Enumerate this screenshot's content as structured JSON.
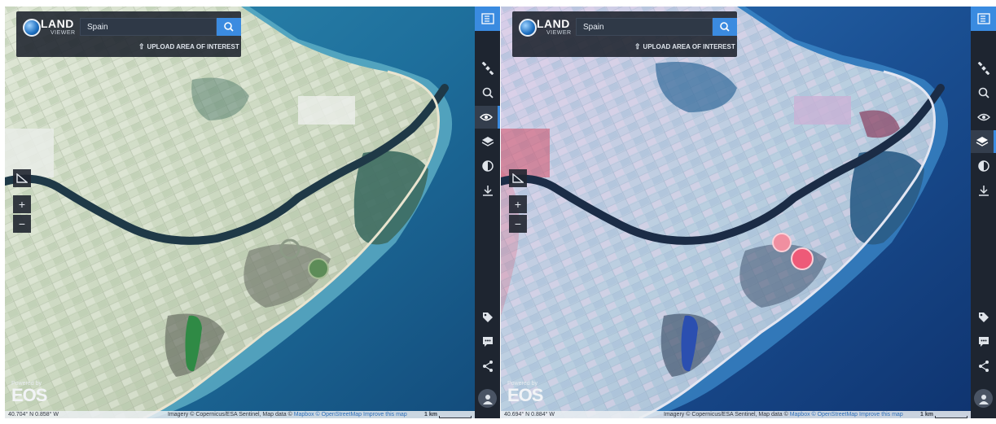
{
  "left": {
    "logo": {
      "word": "LAND",
      "sub": "VIEWER"
    },
    "search": {
      "value": "Spain"
    },
    "upload_label": "UPLOAD AREA OF INTEREST",
    "zoom_in": "+",
    "zoom_out": "−",
    "powered_by": "Powered by",
    "brand": "EOS",
    "coords": "40.704° N 0.858° W",
    "attribution": {
      "prefix": "Imagery © Copernicus/ESA Sentinel, Map data ©",
      "mapbox": "Mapbox",
      "osm": "© OpenStreetMap",
      "improve": "Improve this map"
    },
    "scale": "1 km",
    "active_tool": "view-icon",
    "colors": {
      "land": "#c8d7bf",
      "field_dark": "#6b7a62",
      "sea_deep": "#1c5f8f",
      "river": "#1f3947",
      "lagoon": "#2f5a5c"
    }
  },
  "right": {
    "logo": {
      "word": "LAND",
      "sub": "VIEWER"
    },
    "search": {
      "value": "Spain"
    },
    "upload_label": "UPLOAD AREA OF INTEREST",
    "zoom_in": "+",
    "zoom_out": "−",
    "powered_by": "Powered by",
    "brand": "EOS",
    "coords": "40.694° N 0.884° W",
    "attribution": {
      "prefix": "Imagery © Copernicus/ESA Sentinel, Map data ©",
      "mapbox": "Mapbox",
      "osm": "© OpenStreetMap",
      "improve": "Improve this map"
    },
    "scale": "1 km",
    "active_tool": "layers-icon",
    "colors": {
      "land": "#b9cfe0",
      "field_dark": "#4e5f78",
      "sea_deep": "#143e7a",
      "river": "#1b2c46",
      "lagoon": "#254d70",
      "vegetation": "#e0576f"
    }
  },
  "sidebar_tools": [
    "satellite-icon",
    "search-icon",
    "view-icon",
    "layers-icon",
    "contrast-icon",
    "download-icon",
    "tag-icon",
    "comment-icon",
    "share-icon",
    "user-icon"
  ]
}
